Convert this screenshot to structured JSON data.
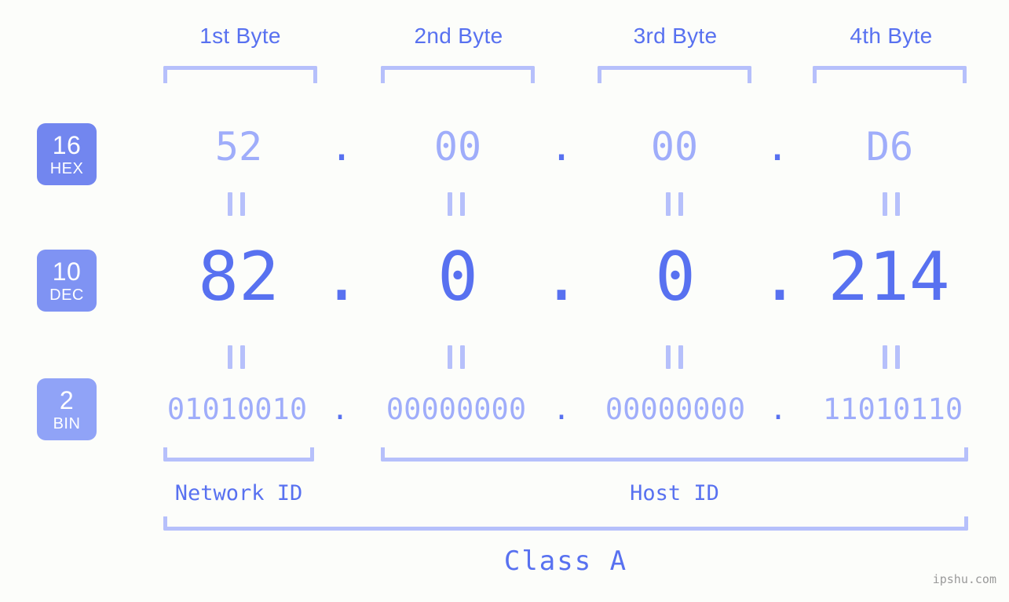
{
  "meta": {
    "watermark": "ipshu.com",
    "colors": {
      "background": "#fcfdfa",
      "accent_strong": "#5871f0",
      "accent_light": "#9fadfa",
      "bracket": "#b6c0fb",
      "badge_hex": "#7286ef",
      "badge_dec": "#7f93f3",
      "badge_bin": "#90a3f7",
      "badge_text": "#ffffff",
      "watermark_text": "#9a9a9a"
    }
  },
  "byte_headers": [
    {
      "label": "1st Byte"
    },
    {
      "label": "2nd Byte"
    },
    {
      "label": "3rd Byte"
    },
    {
      "label": "4th Byte"
    }
  ],
  "bases": [
    {
      "num": "16",
      "abbr": "HEX"
    },
    {
      "num": "10",
      "abbr": "DEC"
    },
    {
      "num": "2",
      "abbr": "BIN"
    }
  ],
  "rows": {
    "hex": {
      "octets": [
        "52",
        "00",
        "00",
        "D6"
      ],
      "separator": "."
    },
    "dec": {
      "octets": [
        "82",
        "0",
        "0",
        "214"
      ],
      "separator": "."
    },
    "bin": {
      "octets": [
        "01010010",
        "00000000",
        "00000000",
        "11010110"
      ],
      "separator": "."
    }
  },
  "sections": {
    "network_id": "Network ID",
    "host_id": "Host ID",
    "class": "Class A"
  },
  "chart_data": {
    "type": "table",
    "title": "IPv4 address 82.0.0.214 byte breakdown",
    "columns": [
      "1st Byte",
      "2nd Byte",
      "3rd Byte",
      "4th Byte"
    ],
    "rows": [
      {
        "base": "16",
        "name": "HEX",
        "values": [
          "52",
          "00",
          "00",
          "D6"
        ]
      },
      {
        "base": "10",
        "name": "DEC",
        "values": [
          "82",
          "0",
          "0",
          "214"
        ]
      },
      {
        "base": "2",
        "name": "BIN",
        "values": [
          "01010010",
          "00000000",
          "00000000",
          "11010110"
        ]
      }
    ],
    "annotations": [
      "Network ID",
      "Host ID",
      "Class A"
    ]
  }
}
